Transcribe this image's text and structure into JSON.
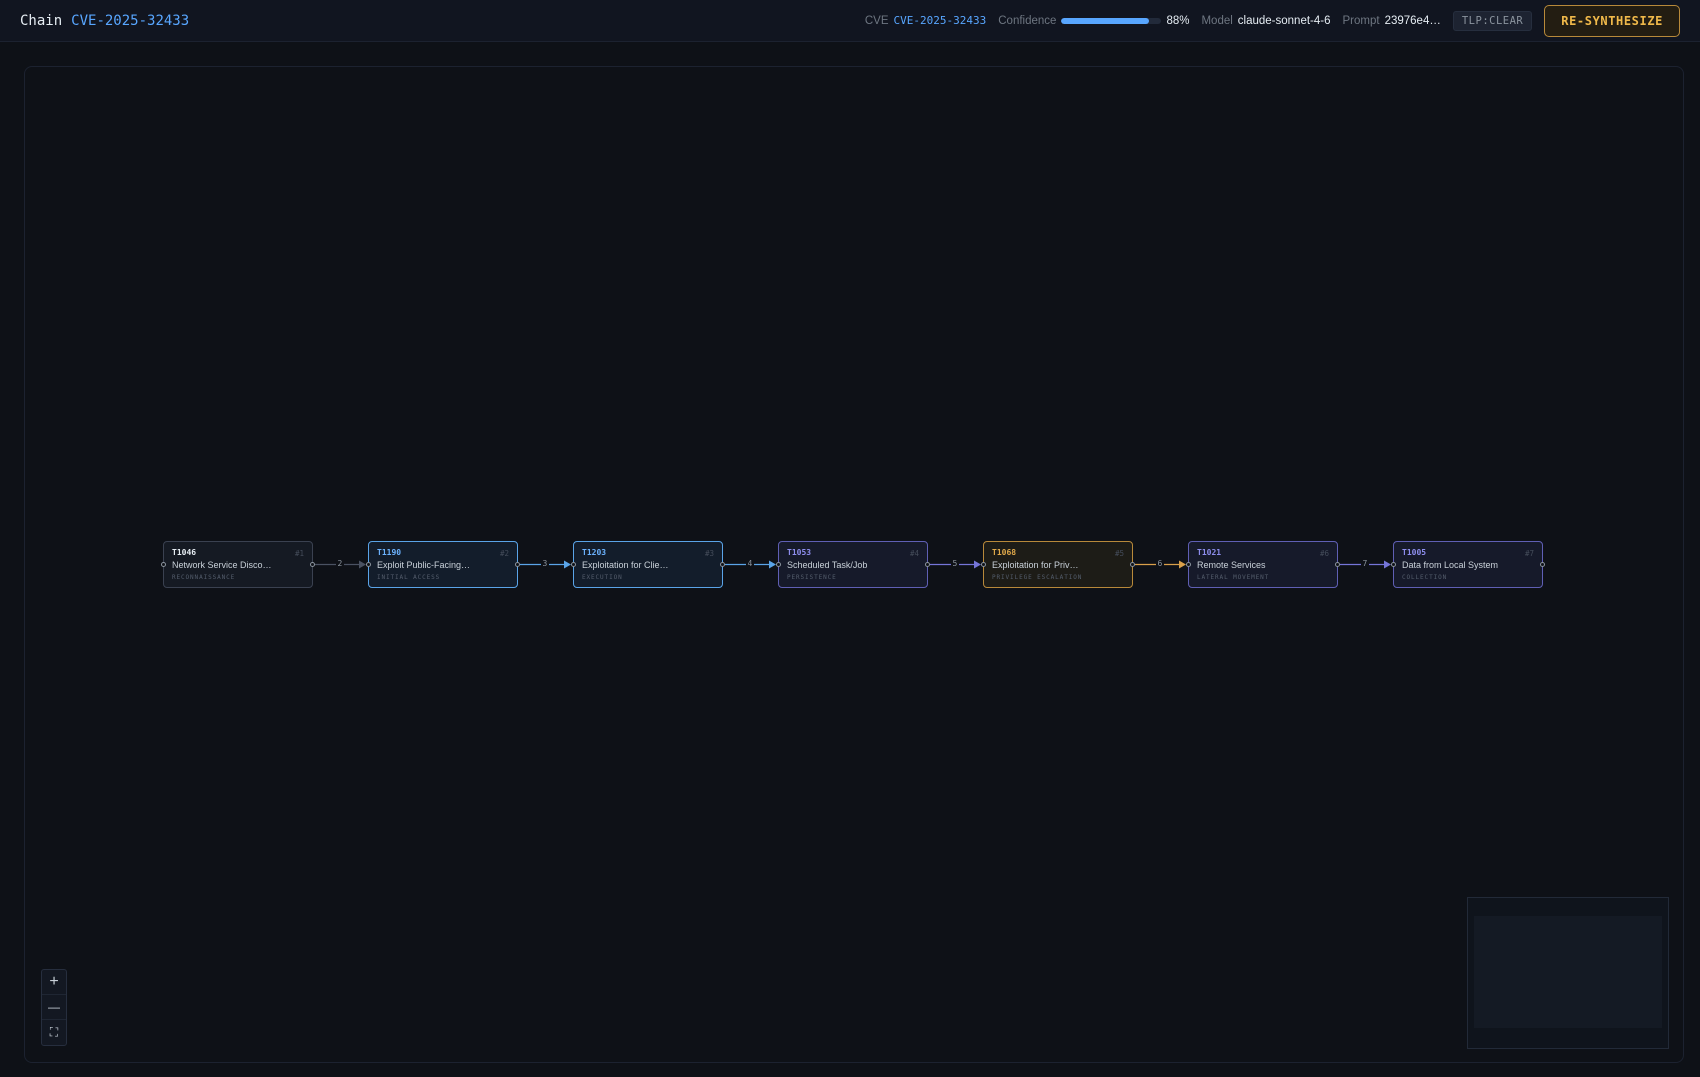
{
  "header": {
    "chain_label": "Chain",
    "chain_cve": "CVE-2025-32433",
    "cve_key": "CVE",
    "cve_value": "CVE-2025-32433",
    "confidence_key": "Confidence",
    "confidence_value": "88%",
    "confidence_fraction": 0.88,
    "model_key": "Model",
    "model_value": "claude-sonnet-4-6",
    "prompt_key": "Prompt",
    "prompt_value": "23976e4…",
    "tlp": "TLP:CLEAR",
    "resynth_label": "RE-SYNTHESIZE"
  },
  "nodes": [
    {
      "id": "T1046",
      "index": "#1",
      "name": "Network Service Disco…",
      "tactic": "RECONNAISSANCE",
      "color": "gray"
    },
    {
      "id": "T1190",
      "index": "#2",
      "name": "Exploit Public-Facing…",
      "tactic": "INITIAL ACCESS",
      "color": "blue"
    },
    {
      "id": "T1203",
      "index": "#3",
      "name": "Exploitation for Clie…",
      "tactic": "EXECUTION",
      "color": "blue"
    },
    {
      "id": "T1053",
      "index": "#4",
      "name": "Scheduled Task/Job",
      "tactic": "PERSISTENCE",
      "color": "purple"
    },
    {
      "id": "T1068",
      "index": "#5",
      "name": "Exploitation for Priv…",
      "tactic": "PRIVILEGE ESCALATION",
      "color": "gold"
    },
    {
      "id": "T1021",
      "index": "#6",
      "name": "Remote Services",
      "tactic": "LATERAL MOVEMENT",
      "color": "purple"
    },
    {
      "id": "T1005",
      "index": "#7",
      "name": "Data from Local System",
      "tactic": "COLLECTION",
      "color": "purple"
    }
  ],
  "edges": [
    {
      "label": "2",
      "color": "#4a5262"
    },
    {
      "label": "3",
      "color": "#5aa4e8"
    },
    {
      "label": "4",
      "color": "#5aa4e8"
    },
    {
      "label": "5",
      "color": "#7575d8"
    },
    {
      "label": "6",
      "color": "#d9a04a"
    },
    {
      "label": "7",
      "color": "#7575d8"
    }
  ],
  "controls": {
    "zoom_in": "+",
    "zoom_out": "—",
    "fit": "⛶"
  }
}
